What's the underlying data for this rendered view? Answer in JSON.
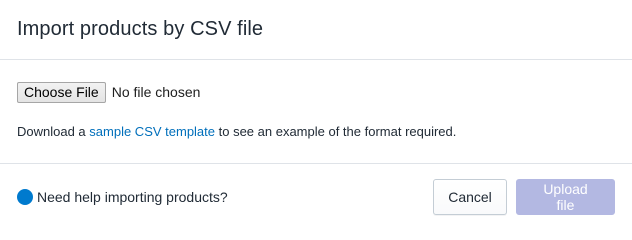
{
  "dialog": {
    "title": "Import products by CSV file"
  },
  "file_input": {
    "button_label": "Choose File",
    "status": "No file chosen"
  },
  "template_note": {
    "prefix": "Download a ",
    "link": "sample CSV template",
    "suffix": " to see an example of the format required."
  },
  "footer": {
    "help_text": "Need help importing products?",
    "cancel_label": "Cancel",
    "upload_label": "Upload file"
  },
  "colors": {
    "link": "#006fbb",
    "help_icon": "#007ace",
    "upload_disabled": "#b3b8e2"
  },
  "icons": {
    "help": "help-circle-icon"
  }
}
